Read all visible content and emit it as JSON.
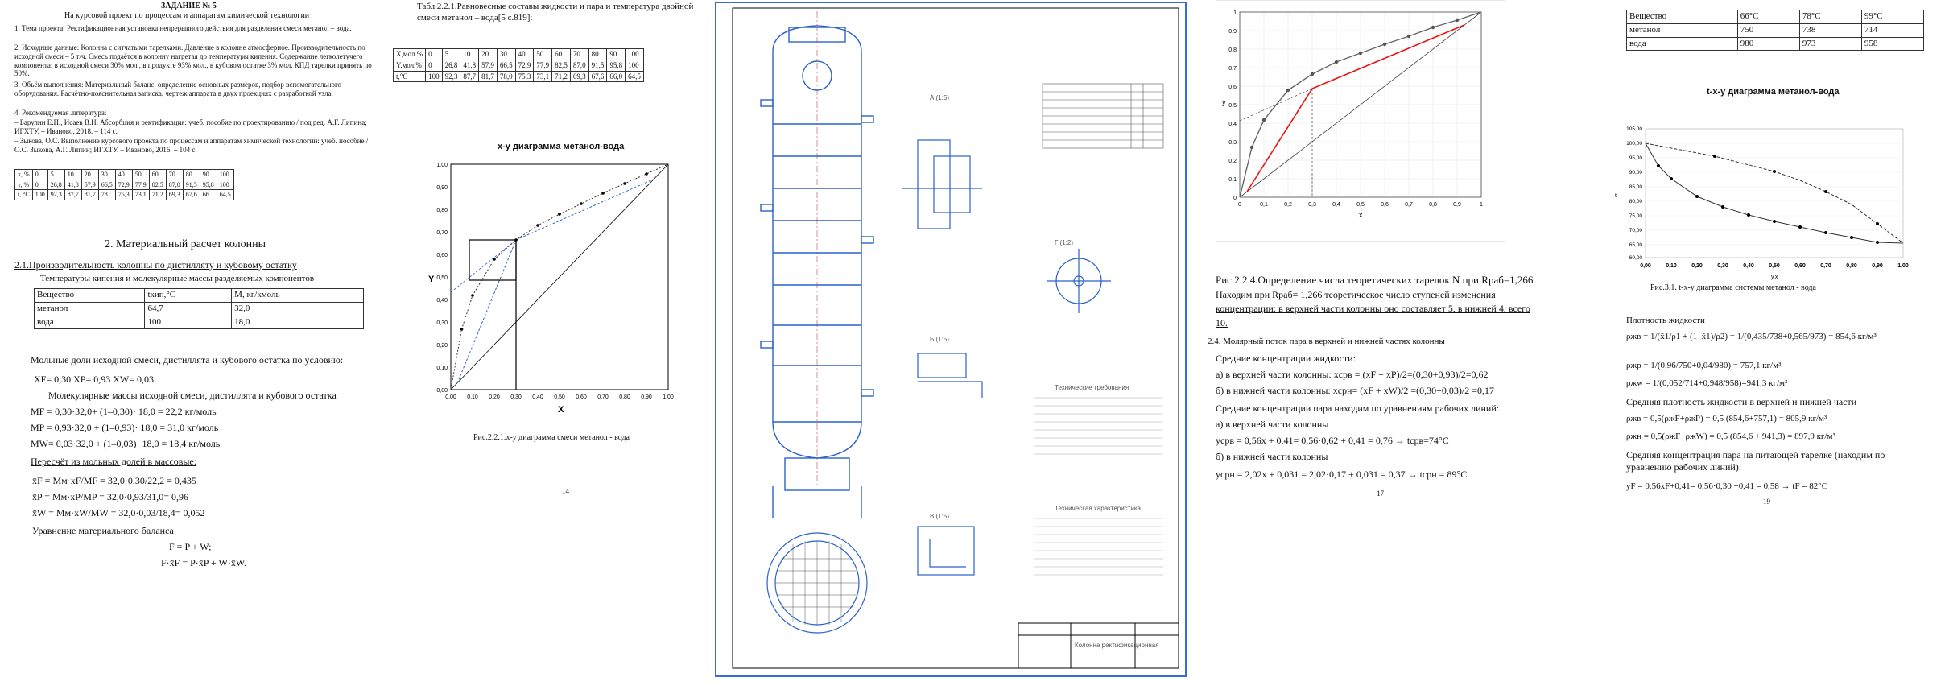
{
  "page1": {
    "header": "ЗАДАНИЕ № 5",
    "subheader": "На курсовой проект по процессам и аппаратам химической технологии",
    "items": [
      "1. Тема проекта: Ректификационная установка непрерывного действия для разделения смеси метанол – вода.",
      "2. Исходные данные: Колонна с ситчатыми тарелками. Давление в колонне атмосферное. Производительность по исходной смеси – 5 т/ч. Смесь подаётся в колонну нагретая до температуры кипения. Содержание легколетучего компонента: в исходной смеси 30% мол., в продукте 93% мол., в кубовом остатке 3% мол. КПД тарелки принять по 50%.",
      "3. Объём выполнения: Материальный баланс, определение основных размеров, подбор вспомогательного оборудования. Расчётно-пояснительная записка, чертеж аппарата в двух проекциях с разработкой узла.",
      "4. Рекомендуемая литература:",
      "– Барулин Е.П., Исаев В.Н. Абсорбция и ректификация: учеб. пособие по проектированию / под ред. А.Г. Липина; ИГХТУ. – Иваново, 2018. – 114 с.",
      "– Зыкова, О.С. Выполнение курсового проекта по процессам и аппаратам химической технологии: учеб. пособие / О.С. Зыкова, А.Г. Липин; ИГХТУ. – Иваново, 2016. – 104 с."
    ],
    "small_table": {
      "row1": [
        "x, %",
        "0",
        "5",
        "10",
        "20",
        "30",
        "40",
        "50",
        "60",
        "70",
        "80",
        "90",
        "100"
      ],
      "row2": [
        "y, %",
        "0",
        "26,8",
        "41,8",
        "57,9",
        "66,5",
        "72,9",
        "77,9",
        "82,5",
        "87,0",
        "91,5",
        "95,8",
        "100"
      ],
      "row3": [
        "t, °C",
        "100",
        "92,3",
        "87,7",
        "81,7",
        "78",
        "75,3",
        "73,1",
        "71,2",
        "69,3",
        "67,6",
        "66",
        "64,5"
      ]
    },
    "section_title": "2. Материальный расчет колонны",
    "subsection": "2.1.Производительность колонны по дистилляту и кубовому остатку",
    "temp_caption": "Температуры кипения и молекулярные массы разделяемых компонентов",
    "comp_table": {
      "headers": [
        "Вещество",
        "tкип,°С",
        "М, кг/кмоль"
      ],
      "rows": [
        [
          "метанол",
          "64,7",
          "32,0"
        ],
        [
          "вода",
          "100",
          "18,0"
        ]
      ]
    },
    "frac_title": "Мольные доли исходной смеси, дистиллята и кубового остатка по условию:",
    "frac_line": "XF= 0,30      XP= 0,93    XW= 0,03",
    "mass_title": "Молекулярные массы исходной смеси, дистиллята и кубового остатка",
    "mass_lines": [
      "MF = 0,30·32,0+ (1–0,30)· 18,0 = 22,2 кг/моль",
      "MP = 0,93·32,0 + (1–0,93)· 18,0 = 31,0 кг/моль",
      "MW= 0,03·32,0 + (1–0,03)· 18,0 = 18,4 кг/моль"
    ],
    "recalc_title": "Пересчёт из мольных долей в массовые:",
    "recalc_lines": [
      "x̄F = Mм·xF/MF  = 32,0·0,30/22,2 = 0,435",
      "x̄P = Mм·xP/MP = 32,0·0,93/31,0= 0,96",
      "x̄W = Mм·xW/MW = 32,0·0,03/18,4= 0,052"
    ],
    "balance_title": "Уравнение материального баланса",
    "balance_lines": [
      "F = P + W;",
      "F·x̄F  = P·x̄P + W·x̄W."
    ]
  },
  "page2": {
    "table_title": "Табл.2.2.1.Равновесные составы жидкости и пара и температура двойной смеси метанол – вода[5 с.819]:",
    "eq_table": {
      "row1": [
        "X,мол.%",
        "0",
        "5",
        "10",
        "20",
        "30",
        "40",
        "50",
        "60",
        "70",
        "80",
        "90",
        "100"
      ],
      "row2": [
        "Y,мол.%",
        "0",
        "26,8",
        "41,8",
        "57,9",
        "66,5",
        "72,9",
        "77,9",
        "82,5",
        "87,0",
        "91,5",
        "95,8",
        "100"
      ],
      "row3": [
        "t,°C",
        "100",
        "92,3",
        "87,7",
        "81,7",
        "78,0",
        "75,3",
        "73,1",
        "71,2",
        "69,3",
        "67,6",
        "66,0",
        "64,5"
      ]
    },
    "chart_title": "x-y диаграмма метанол-вода",
    "x_axis_label": "X",
    "y_axis_label": "Y",
    "x_ticks": [
      "0,00",
      "0,10",
      "0,20",
      "0,30",
      "0,40",
      "0,50",
      "0,60",
      "0,70",
      "0,80",
      "0,90",
      "1,00"
    ],
    "y_ticks": [
      "1,00",
      "0,90",
      "0,80",
      "0,70",
      "0,60",
      "0,50",
      "0,40",
      "0,30",
      "0,20",
      "0,10",
      "0,00"
    ],
    "caption": "Рис.2.2.1.х-у диаграмма смеси метанол - вода",
    "page_num": "14"
  },
  "drawing": {
    "section_labels": [
      "А (1:5)",
      "Б (1:5)",
      "В (1:5)",
      "Г (1:2)"
    ],
    "note1": "Технические требования",
    "note2": "Техническая характеристика",
    "title_block": "Колонна ректификационная"
  },
  "page4": {
    "x_ticks": [
      "0",
      "0,1",
      "0,2",
      "0,3",
      "0,4",
      "0,5",
      "0,6",
      "0,7",
      "0,8",
      "0,9",
      "1"
    ],
    "y_ticks": [
      "1",
      "0,9",
      "0,8",
      "0,7",
      "0,6",
      "0,5",
      "0,4",
      "0,3",
      "0,2",
      "0,1",
      "0"
    ],
    "x_axis_label": "x",
    "y_axis_label": "y",
    "caption": "Рис.2.2.4.Определение числа теоретических тарелок N при Rраб=1,266",
    "lines": [
      "Находим при Rраб= 1,266 теоретическое число ступеней изменения концентрации: в верхней части колонны оно составляет 5, в нижней 4, всего 10.",
      "2.4. Молярный поток пара в верхней и нижней частях колонны",
      "Средние концентрации жидкости:",
      "а) в верхней части колонны: xсрв = (xF + xP)/2=(0,30+0,93)/2=0,62",
      "б) в нижней части колонны: xсрн= (xF + xW)/2 =(0,30+0,03)/2 =0,17",
      "Средние концентрации пара находим по уравнениям рабочих линий:",
      "а) в верхней части колонны",
      "yсрв = 0,56x + 0,41= 0,56·0,62 + 0,41 = 0,76 → tсрв=74°C",
      "б) в нижней части колонны",
      "yсрн = 2,02x + 0,031 = 2,02·0,17 + 0,031 = 0,37 → tсрн = 89°C"
    ],
    "page_num": "17"
  },
  "page5": {
    "dens_table": {
      "headers": [
        "Вещество",
        "66°C",
        "78°C",
        "99°C"
      ],
      "rows": [
        [
          "метанол",
          "750",
          "738",
          "714"
        ],
        [
          "вода",
          "980",
          "973",
          "958"
        ]
      ]
    },
    "chart_title": "t-x-y диаграмма метанол-вода",
    "x_axis_label": "y,x",
    "y_axis_label": "t",
    "x_ticks": [
      "0,00",
      "0,10",
      "0,20",
      "0,30",
      "0,40",
      "0,50",
      "0,60",
      "0,70",
      "0,80",
      "0,90",
      "1,00"
    ],
    "y_ticks": [
      "105,00",
      "100,00",
      "95,00",
      "90,00",
      "85,00",
      "80,00",
      "75,00",
      "70,00",
      "65,00",
      "60,00"
    ],
    "caption": "Рис.3.1. t-x-y диаграмма системы метанол - вода",
    "lines": [
      "Плотность жидкости",
      "ρжв = 1/(x̄1/ρ1 + (1–x̄1)/ρ2) = 1/(0,435/738+0,565/973) = 854,6 кг/м³",
      "ρжр = 1/(0,96/750+0,04/980) = 757,1 кг/м³",
      "ρжw = 1/(0,052/714+0,948/958)=941,3 кг/м³",
      "Средняя плотность жидкости в верхней и нижней части",
      "ρжв = 0,5(ρжF+ρжP) = 0,5 (854,6+757,1) = 805,9 кг/м³",
      "ρжн = 0,5(ρжF+ρжW) = 0,5 (854,6 + 941,3) = 897,9 кг/м³",
      "Средняя концентрация пара на питающей тарелке (находим по уравнению рабочих линий):",
      "yF = 0,56xF+0,41= 0,56·0,30 +0,41 = 0,58 → tF = 82°C"
    ],
    "page_num": "19"
  }
}
